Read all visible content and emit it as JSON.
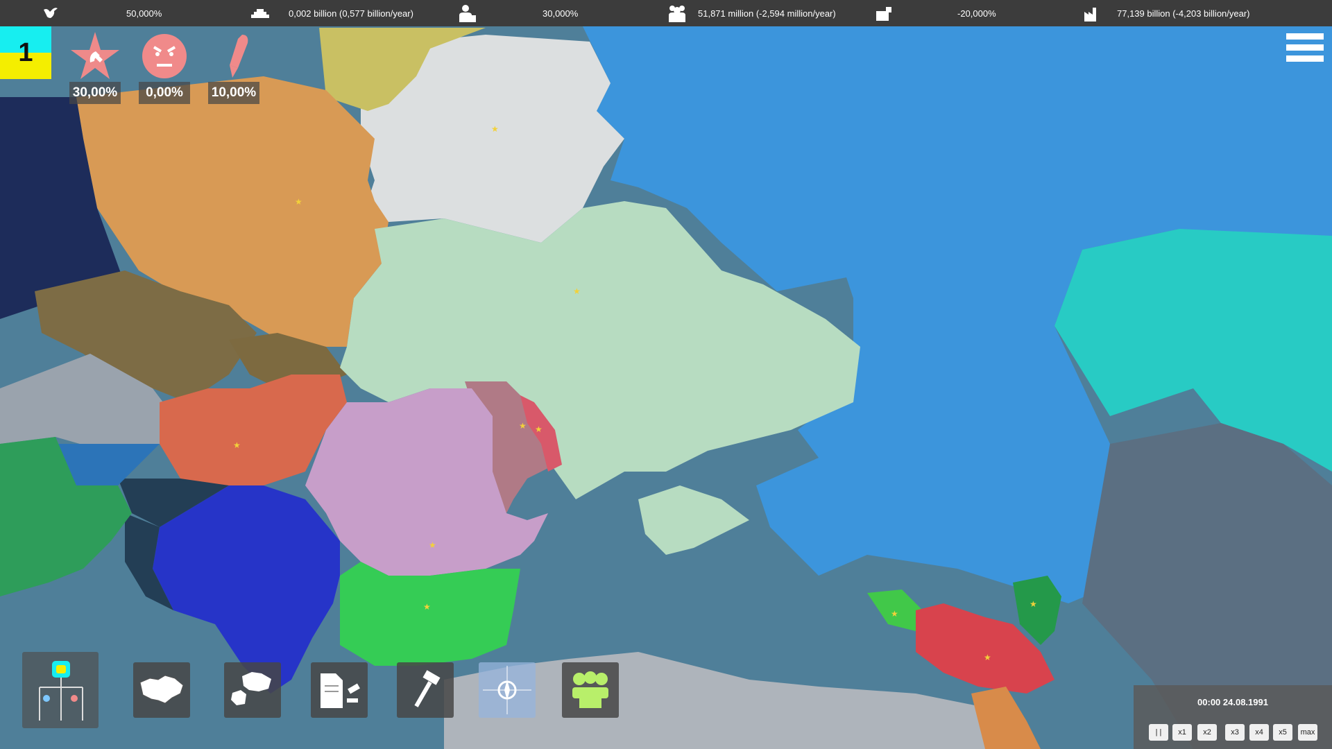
{
  "topbar": {
    "stats": [
      {
        "icon": "dove-icon",
        "value": "50,000%"
      },
      {
        "icon": "money-stack-icon",
        "value": "0,002 billion (0,577 billion/year)"
      },
      {
        "icon": "worker-icon",
        "value": "30,000%"
      },
      {
        "icon": "population-icon",
        "value": "51,871 million (-2,594 million/year)"
      },
      {
        "icon": "tax-icon",
        "value": "-20,000%"
      },
      {
        "icon": "factory-icon",
        "value": "77,139 billion (-4,203 billion/year)"
      }
    ]
  },
  "flag": {
    "number": "1",
    "colors": [
      "#17eef0",
      "#f4ee00"
    ]
  },
  "indicators": [
    {
      "icon": "communist-star-icon",
      "value": "30,00%"
    },
    {
      "icon": "angry-face-icon",
      "value": "0,00%"
    },
    {
      "icon": "pencil-icon",
      "value": "10,00%"
    }
  ],
  "toolbar": {
    "buttons": [
      {
        "name": "politics-hierarchy-button",
        "icon": "hierarchy-icon"
      },
      {
        "name": "regions-map-button",
        "icon": "ukraine-map-icon"
      },
      {
        "name": "territory-split-button",
        "icon": "map-split-icon"
      },
      {
        "name": "laws-button",
        "icon": "document-gavel-icon"
      },
      {
        "name": "build-button",
        "icon": "hammer-icon"
      },
      {
        "name": "nato-button",
        "icon": "nato-compass-icon"
      },
      {
        "name": "population-groups-button",
        "icon": "people-group-icon"
      }
    ]
  },
  "time": {
    "datetime": "00:00 24.08.1991",
    "speeds": [
      "| |",
      "x1",
      "x2",
      "x3",
      "x4",
      "x5",
      "max"
    ]
  },
  "colors": {
    "sea": "#4f7f99",
    "ukraine": "#b7dcc1",
    "russia": "#3c95dc",
    "belarus": "#dcdfe0",
    "poland": "#d89a55",
    "romania": "#c79ec9",
    "moldova": "#b07a86",
    "bulgaria": "#35cc55",
    "hungary": "#d8694d",
    "serbia": "#2634c8",
    "kazakhstan": "#28cbc4",
    "georgia": "#d8434d"
  }
}
